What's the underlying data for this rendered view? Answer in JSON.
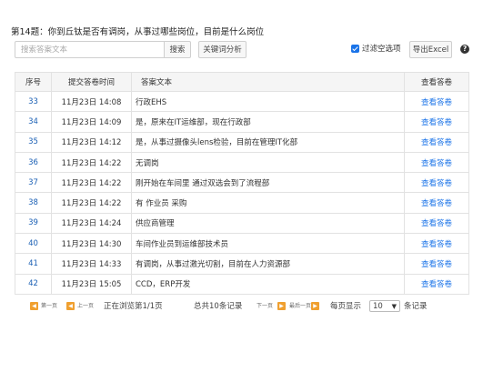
{
  "title": "第14题：你到丘钛是否有调岗，从事过哪些岗位，目前是什么岗位",
  "toolbar": {
    "search_placeholder": "搜索答案文本",
    "search_label": "搜索",
    "keyword_label": "关键词分析",
    "filter_label": "过滤空选项",
    "filter_checked": true,
    "export_label": "导出Excel"
  },
  "table": {
    "headers": [
      "序号",
      "提交答卷时间",
      "答案文本",
      "查看答卷"
    ],
    "rows": [
      {
        "no": "33",
        "time": "11月23日 14:08",
        "answer": "行政EHS",
        "view": "查看答卷"
      },
      {
        "no": "34",
        "time": "11月23日 14:09",
        "answer": "是，原来在IT运维部，现在行政部",
        "view": "查看答卷"
      },
      {
        "no": "35",
        "time": "11月23日 14:12",
        "answer": "是，从事过摄像头lens检验，目前在管理IT化部",
        "view": "查看答卷"
      },
      {
        "no": "36",
        "time": "11月23日 14:22",
        "answer": "无调岗",
        "view": "查看答卷"
      },
      {
        "no": "37",
        "time": "11月23日 14:22",
        "answer": "刚开始在车间里 通过双选会到了流程部",
        "view": "查看答卷"
      },
      {
        "no": "38",
        "time": "11月23日 14:22",
        "answer": "有 作业员 采购",
        "view": "查看答卷"
      },
      {
        "no": "39",
        "time": "11月23日 14:24",
        "answer": "供应商管理",
        "view": "查看答卷"
      },
      {
        "no": "40",
        "time": "11月23日 14:30",
        "answer": "车间作业员到运维部技术员",
        "view": "查看答卷"
      },
      {
        "no": "41",
        "time": "11月23日 14:33",
        "answer": "有调岗，从事过激光切割，目前在人力资源部",
        "view": "查看答卷"
      },
      {
        "no": "42",
        "time": "11月23日 15:05",
        "answer": "CCD，ERP开发",
        "view": "查看答卷"
      }
    ]
  },
  "pager": {
    "first_label": "第一页",
    "prev_label": "上一页",
    "status": "正在浏览第1/1页",
    "total": "总共10条记录",
    "next_label": "下一页",
    "last_label": "最后一页",
    "per_page_prefix": "每页显示",
    "per_page_value": "10",
    "per_page_suffix": "条记录"
  },
  "colors": {
    "accent": "#1a73e8",
    "pager_icon": "#f0a030"
  }
}
